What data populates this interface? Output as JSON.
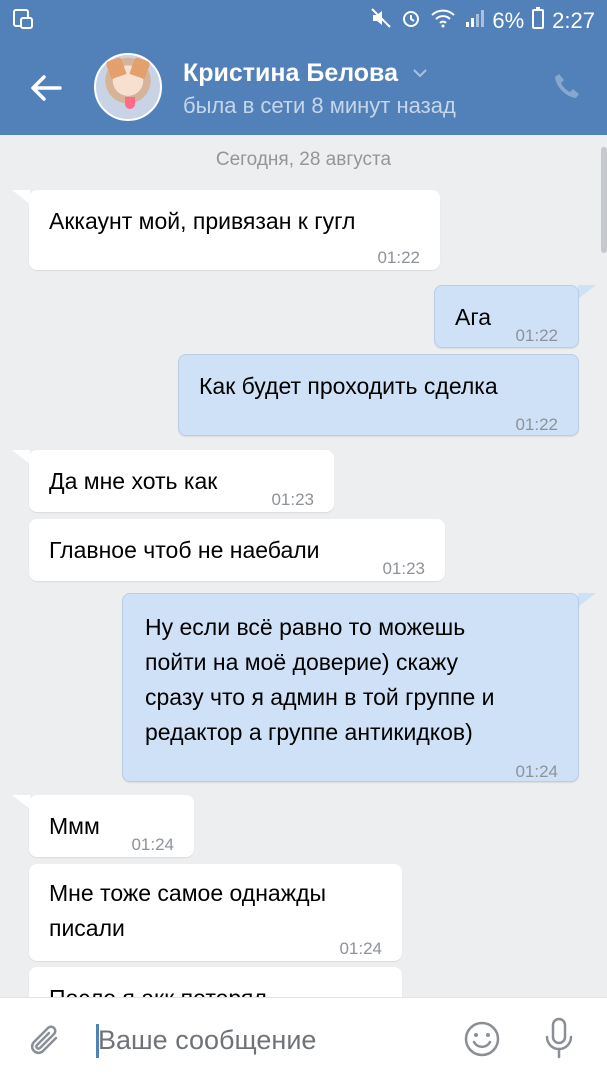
{
  "status_bar": {
    "battery": "6%",
    "time": "2:27"
  },
  "header": {
    "contact_name": "Кристина Белова",
    "contact_status": "была в сети 8 минут назад"
  },
  "chat": {
    "date_separator": "Сегодня, 28 августа",
    "messages": [
      {
        "direction": "in",
        "text": "Аккаунт мой, привязан к гугл",
        "time": "01:22"
      },
      {
        "direction": "out",
        "text": "Ага",
        "time": "01:22"
      },
      {
        "direction": "out",
        "text": "Как будет проходить сделка",
        "time": "01:22"
      },
      {
        "direction": "in",
        "text": "Да мне хоть как",
        "time": "01:23"
      },
      {
        "direction": "in",
        "text": "Главное чтоб не наебали",
        "time": "01:23"
      },
      {
        "direction": "out",
        "lines": [
          "Ну если всё равно то можешь",
          "пойти на моё доверие) скажу",
          "сразу что я админ в той группе и",
          "редактор а группе антикидков)"
        ],
        "time": "01:24"
      },
      {
        "direction": "in",
        "text": "Ммм",
        "time": "01:24"
      },
      {
        "direction": "in",
        "lines": [
          "Мне тоже самое однажды",
          "писали"
        ],
        "time": "01:24"
      },
      {
        "direction": "in",
        "text": "После я акк потерял",
        "time": ""
      }
    ]
  },
  "composer": {
    "placeholder": "Ваше сообщение"
  },
  "colors": {
    "accent": "#5181b8",
    "outgoing_bubble": "#cfe1f6",
    "incoming_bubble": "#ffffff",
    "background": "#edeef0"
  },
  "icons": [
    "back-arrow-icon",
    "chevron-down-icon",
    "phone-icon",
    "paperclip-icon",
    "smile-icon",
    "microphone-icon"
  ]
}
